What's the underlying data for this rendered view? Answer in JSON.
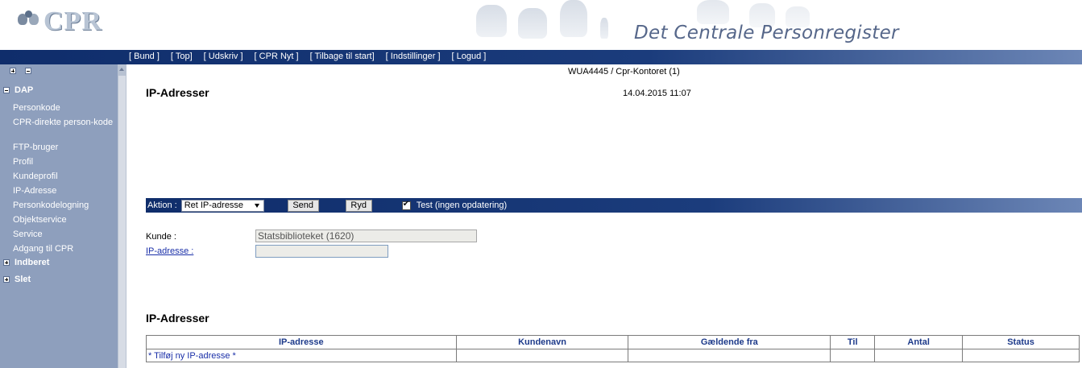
{
  "header": {
    "logo_text": "CPR",
    "site_title": "Det Centrale Personregister"
  },
  "topnav": {
    "links": [
      "[ Bund ]",
      "[ Top]",
      "[ Udskriv ]",
      "[ CPR Nyt ]",
      "[ Tilbage til start]",
      "[ Indstillinger ]",
      "[ Logud ]"
    ]
  },
  "sidebar": {
    "groups": {
      "dap": "DAP",
      "indberet": "Indberet",
      "slet": "Slet"
    },
    "items": [
      "Personkode",
      "CPR-direkte person-kode",
      "FTP-bruger",
      "Profil",
      "Kundeprofil",
      "IP-Adresse",
      "Personkodelogning",
      "Objektservice",
      "Service",
      "Adgang til CPR"
    ]
  },
  "main": {
    "user_info": "WUA4445  /  Cpr-Kontoret (1)",
    "page_title": "IP-Adresser",
    "datetime": "14.04.2015 11:07",
    "actionbar": {
      "aktion_label": "Aktion :",
      "aktion_value": "Ret IP-adresse",
      "send_label": "Send",
      "ryd_label": "Ryd",
      "test_label": "Test (ingen opdatering)",
      "test_checked": true
    },
    "form": {
      "kunde_label": "Kunde :",
      "kunde_value": "Statsbiblioteket (1620)",
      "ip_label": "IP-adresse :",
      "ip_value": ""
    },
    "list": {
      "title": "IP-Adresser",
      "columns": [
        "IP-adresse",
        "Kundenavn",
        "Gældende fra",
        "Til",
        "Antal",
        "Status"
      ],
      "rows": [
        [
          "* Tilføj ny IP-adresse *",
          "",
          "",
          "",
          "",
          ""
        ]
      ]
    }
  },
  "colors": {
    "nav_bar": "#1b3c7c",
    "sidebar_bg": "#8e9fbd",
    "link": "#1a2fa8",
    "table_header_text": "#1d3a8a"
  }
}
